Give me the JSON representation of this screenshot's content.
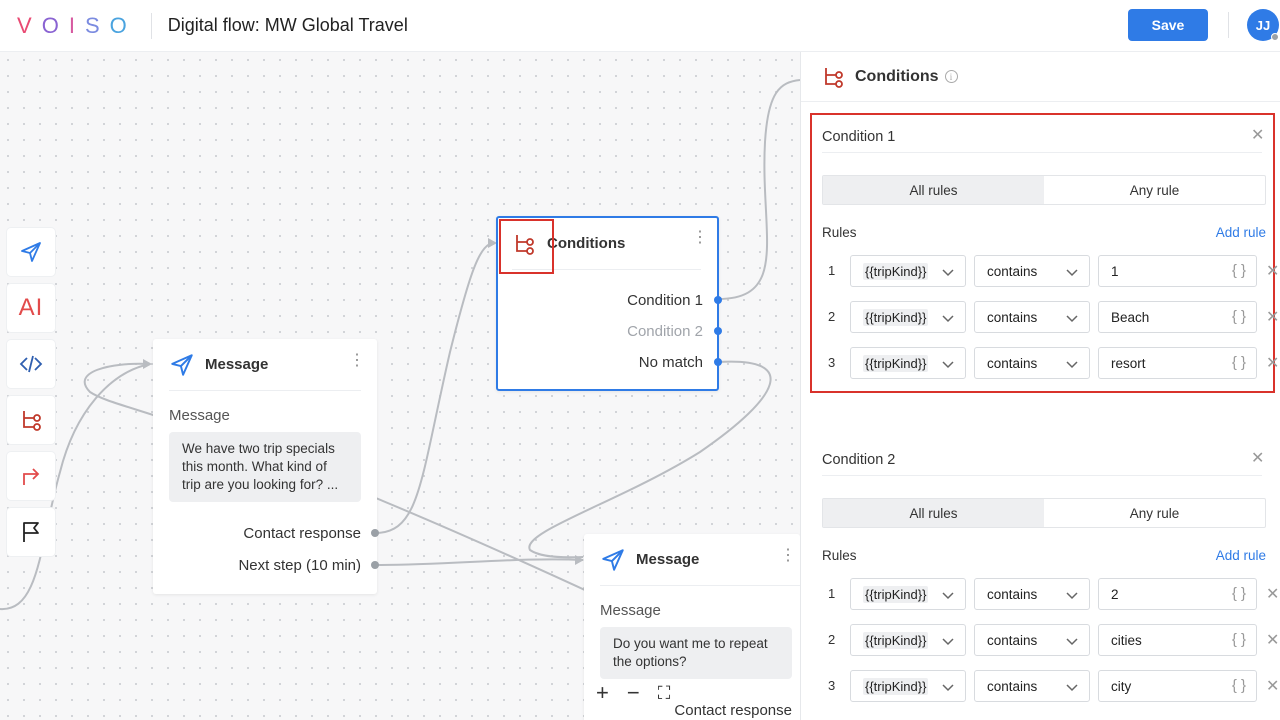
{
  "header": {
    "logo_letters": [
      "V",
      "O",
      "I",
      "S",
      "O"
    ],
    "logo_colors": [
      "#e94a73",
      "#8a63d2",
      "#d65aa0",
      "#7b8be0",
      "#4aa3df"
    ],
    "title": "Digital flow: MW Global Travel",
    "save_label": "Save",
    "avatar_initials": "JJ"
  },
  "toolbar": {
    "items": [
      {
        "name": "send-message-tool",
        "icon": "paper-plane-icon"
      },
      {
        "name": "ai-tool",
        "label": "AI"
      },
      {
        "name": "code-tool",
        "icon": "code-icon"
      },
      {
        "name": "conditions-tool",
        "icon": "branch-icon"
      },
      {
        "name": "redirect-tool",
        "icon": "redirect-arrow-icon"
      },
      {
        "name": "end-flag-tool",
        "icon": "flag-icon"
      }
    ]
  },
  "nodes": {
    "message1": {
      "title": "Message",
      "label": "Message",
      "text": "We have two trip specials this month. What kind of trip are you looking for? ...",
      "outputs": [
        "Contact response",
        "Next step (10 min)"
      ]
    },
    "conditions": {
      "title": "Conditions",
      "outputs": [
        "Condition 1",
        "Condition 2",
        "No match"
      ]
    },
    "message2": {
      "title": "Message",
      "label": "Message",
      "text": "Do you want me to repeat the options?",
      "outputs": [
        "Contact response"
      ]
    }
  },
  "zoom": {
    "plus": "+",
    "minus": "−",
    "fit": "⛶"
  },
  "panel": {
    "title": "Conditions",
    "conditions": [
      {
        "name": "Condition 1",
        "tabs": [
          "All rules",
          "Any rule"
        ],
        "active_tab": "All rules",
        "rules_label": "Rules",
        "add_rule": "Add rule",
        "rules": [
          {
            "num": "1",
            "variable": "{{tripKind}}",
            "operator": "contains",
            "value": "1"
          },
          {
            "num": "2",
            "variable": "{{tripKind}}",
            "operator": "contains",
            "value": "Beach"
          },
          {
            "num": "3",
            "variable": "{{tripKind}}",
            "operator": "contains",
            "value": "resort"
          }
        ]
      },
      {
        "name": "Condition 2",
        "tabs": [
          "All rules",
          "Any rule"
        ],
        "active_tab": "All rules",
        "rules_label": "Rules",
        "add_rule": "Add rule",
        "rules": [
          {
            "num": "1",
            "variable": "{{tripKind}}",
            "operator": "contains",
            "value": "2"
          },
          {
            "num": "2",
            "variable": "{{tripKind}}",
            "operator": "contains",
            "value": "cities"
          },
          {
            "num": "3",
            "variable": "{{tripKind}}",
            "operator": "contains",
            "value": "city"
          }
        ]
      }
    ]
  },
  "colors": {
    "accent": "#2f7be6",
    "highlight": "#d9322b",
    "conditions_icon": "#c0392b",
    "disabled_text": "#a0a4aa"
  }
}
